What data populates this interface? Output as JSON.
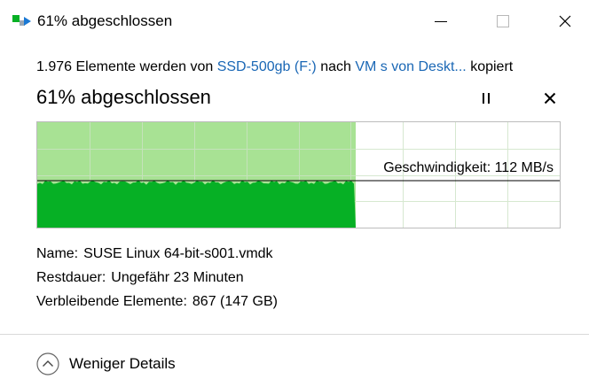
{
  "window": {
    "title": "61% abgeschlossen",
    "icon": "copy-progress-icon",
    "controls": [
      "minimize-icon",
      "maximize-icon",
      "close-icon"
    ]
  },
  "copy_info": {
    "count_text": "1.976 Elemente werden von",
    "source": "SSD-500gb (F:)",
    "nach": "nach",
    "destination": "VM s von Deskt...",
    "kopiert": "kopiert"
  },
  "progress": {
    "status": "61% abgeschlossen",
    "fraction": 0.61,
    "speed_text": "Geschwindigkeit: 112 MB/s"
  },
  "details": {
    "name_label": "Name:",
    "name_value": "SUSE Linux 64-bit-s001.vmdk",
    "rest_label": "Restdauer:",
    "rest_value": "Ungefähr 23 Minuten",
    "remaining_label": "Verbleibende Elemente:",
    "remaining_value": "867 (147 GB)"
  },
  "footer": {
    "less_details": "Weniger Details"
  },
  "colors": {
    "link": "#1a67b5",
    "progress_fill": "#a8e294",
    "graph_fill": "#06b025",
    "graph_border": "#bcbcbc"
  }
}
